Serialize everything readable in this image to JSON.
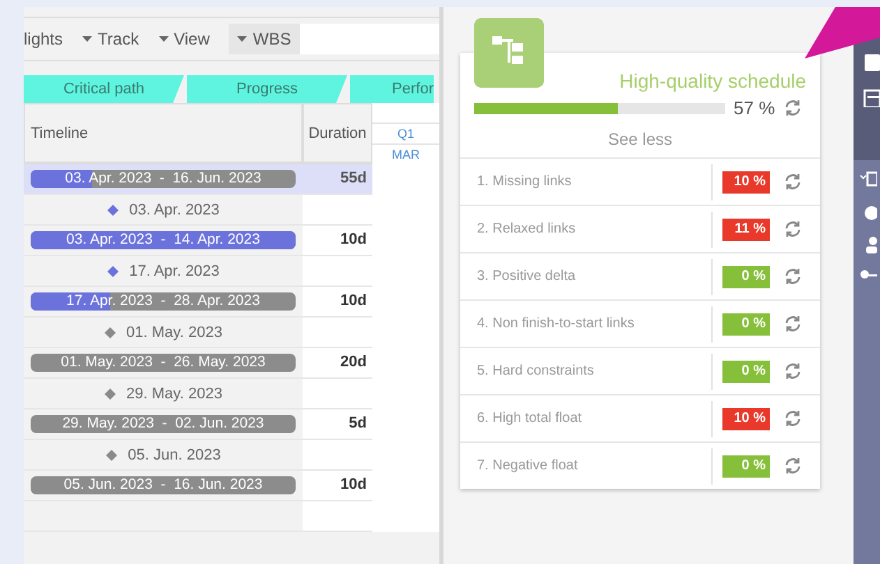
{
  "toolbar": {
    "items": [
      {
        "label": "lights",
        "kind": "text"
      },
      {
        "label": "Track",
        "kind": "dropdown"
      },
      {
        "label": "View",
        "kind": "dropdown"
      },
      {
        "label": "WBS",
        "kind": "dropdown"
      }
    ]
  },
  "tabs": [
    {
      "label": "Critical path",
      "selected": false
    },
    {
      "label": "Progress",
      "selected": false
    },
    {
      "label": "Perfor",
      "selected": false
    }
  ],
  "table": {
    "columns": [
      "Timeline",
      "Duration"
    ],
    "chart_header": {
      "quarter": "Q1",
      "month": "MAR"
    },
    "rows": [
      {
        "kind": "bar",
        "dates": "03. Apr. 2023  -  16. Jun. 2023",
        "duration": "55d",
        "level": 0.23,
        "selected": true
      },
      {
        "kind": "milestone",
        "dates": "03. Apr. 2023",
        "color": "#6b72dc"
      },
      {
        "kind": "bar",
        "dates": "03. Apr. 2023  -  14. Apr. 2023",
        "duration": "10d",
        "level": 1,
        "selected": false
      },
      {
        "kind": "milestone",
        "dates": "17. Apr. 2023",
        "color": "#6b72dc"
      },
      {
        "kind": "bar",
        "dates": "17. Apr. 2023  -  28. Apr. 2023",
        "duration": "10d",
        "level": 0.3,
        "selected": false
      },
      {
        "kind": "milestone",
        "dates": "01. May. 2023",
        "color": "#8a8a8a"
      },
      {
        "kind": "bar",
        "dates": "01. May. 2023  -  26. May. 2023",
        "duration": "20d",
        "level": 0,
        "selected": false
      },
      {
        "kind": "milestone",
        "dates": "29. May. 2023",
        "color": "#8a8a8a"
      },
      {
        "kind": "bar",
        "dates": "29. May. 2023  -  02. Jun. 2023",
        "duration": "5d",
        "level": 0,
        "selected": false
      },
      {
        "kind": "milestone",
        "dates": "05. Jun. 2023",
        "color": "#8a8a8a"
      },
      {
        "kind": "bar",
        "dates": "05. Jun. 2023  -  16. Jun. 2023",
        "duration": "10d",
        "level": 0,
        "selected": false
      }
    ]
  },
  "quality": {
    "title": "High-quality schedule",
    "level": 0.57,
    "percent": "57 %",
    "toggle": "See less",
    "checks": [
      {
        "label": "1. Missing links",
        "value": "10 %",
        "color": "#e8392b"
      },
      {
        "label": "2. Relaxed links",
        "value": "11 %",
        "color": "#e8392b"
      },
      {
        "label": "3. Positive delta",
        "value": "0 %",
        "color": "#86bf3a"
      },
      {
        "label": "4. Non finish-to-start links",
        "value": "0 %",
        "color": "#86bf3a"
      },
      {
        "label": "5. Hard constraints",
        "value": "0 %",
        "color": "#86bf3a"
      },
      {
        "label": "6. High total float",
        "value": "10 %",
        "color": "#e8392b"
      },
      {
        "label": "7. Negative float",
        "value": "0 %",
        "color": "#86bf3a"
      }
    ]
  }
}
